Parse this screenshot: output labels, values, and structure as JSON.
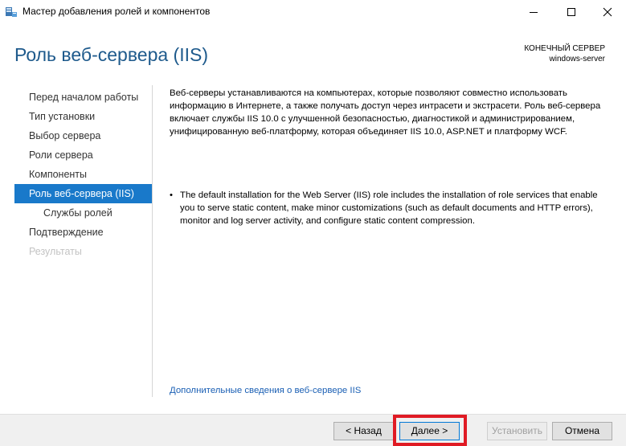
{
  "window": {
    "title": "Мастер добавления ролей и компонентов",
    "icon": "server-manager-wizard-icon",
    "controls": [
      "minimize-icon",
      "maximize-icon",
      "close-icon"
    ]
  },
  "header": {
    "title": "Роль веб-сервера (IIS)",
    "target_label": "КОНЕЧНЫЙ СЕРВЕР",
    "target_name": "windows-server"
  },
  "nav": {
    "items": [
      {
        "label": "Перед началом работы",
        "state": "normal"
      },
      {
        "label": "Тип установки",
        "state": "normal"
      },
      {
        "label": "Выбор сервера",
        "state": "normal"
      },
      {
        "label": "Роли сервера",
        "state": "normal"
      },
      {
        "label": "Компоненты",
        "state": "normal"
      },
      {
        "label": "Роль веб-сервера (IIS)",
        "state": "active"
      },
      {
        "label": "Службы ролей",
        "state": "sub"
      },
      {
        "label": "Подтверждение",
        "state": "normal"
      },
      {
        "label": "Результаты",
        "state": "disabled"
      }
    ]
  },
  "content": {
    "intro": "Веб-серверы устанавливаются на компьютерах, которые позволяют совместно использовать информацию в Интернете, а также получать доступ через интрасети и экстрасети. Роль веб-сервера включает службы IIS 10.0 с улучшенной безопасностью, диагностикой и администрированием, унифицированную веб-платформу, которая объединяет IIS 10.0, ASP.NET и платформу WCF.",
    "bullet": "The default installation for the Web Server (IIS) role includes the installation of role services that enable you to serve static content, make minor customizations (such as default documents and HTTP errors), monitor and log server activity, and configure static content compression.",
    "link": "Дополнительные сведения о веб-сервере IIS"
  },
  "footer": {
    "back": "< Назад",
    "next": "Далее >",
    "install": "Установить",
    "cancel": "Отмена"
  },
  "colors": {
    "accent": "#1979ca",
    "title": "#1e5a8c",
    "highlight": "#e01b24"
  }
}
